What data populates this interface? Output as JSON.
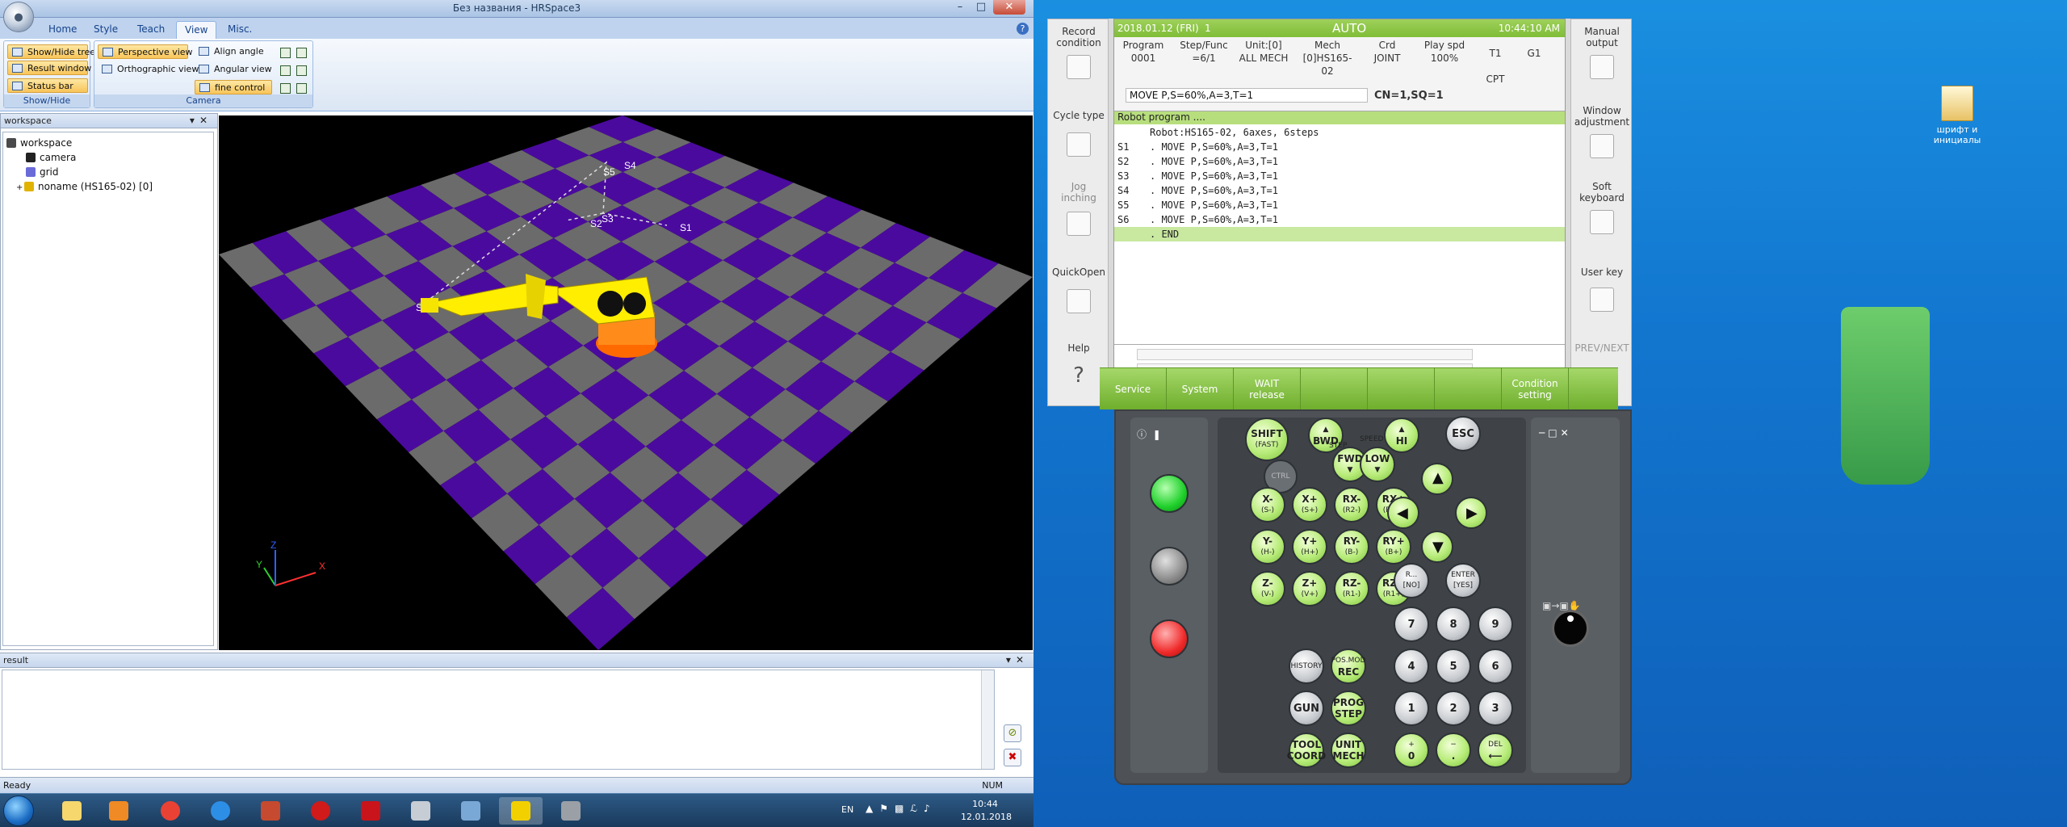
{
  "app": {
    "window_title": "Без названия - HRSpace3",
    "orb_glyph": "●"
  },
  "ribbon": {
    "tabs": [
      {
        "label": "Home"
      },
      {
        "label": "Style"
      },
      {
        "label": "Teach"
      },
      {
        "label": "View"
      },
      {
        "label": "Misc."
      }
    ],
    "active_tab": "View",
    "groups": {
      "showhide": {
        "label": "Show/Hide",
        "buttons": [
          "Show/Hide tree",
          "Result window",
          "Status bar"
        ]
      },
      "camera": {
        "label": "Camera",
        "buttons": [
          "Perspective view",
          "Orthographic view",
          "Align angle",
          "Angular view",
          "fine control"
        ]
      }
    }
  },
  "workspace": {
    "panel_title": "workspace",
    "tree": [
      {
        "label": "workspace",
        "level": 0
      },
      {
        "label": "camera",
        "level": 1
      },
      {
        "label": "grid",
        "level": 1
      },
      {
        "label": "noname (HS165-02) [0]",
        "level": 1
      }
    ]
  },
  "viewport": {
    "step_labels": [
      "S1",
      "S2",
      "S3",
      "S4",
      "S5",
      "S6"
    ],
    "axis_labels": [
      "X",
      "Y",
      "Z"
    ],
    "colors": {
      "floor_a": "#4b0a9e",
      "floor_b": "#6b6b6b",
      "robot": "#ffee00",
      "base": "#ff6a00"
    }
  },
  "result": {
    "panel_title": "result"
  },
  "statusbar": {
    "text": "Ready",
    "num": "NUM"
  },
  "taskbar": {
    "lang": "EN",
    "time": "10:44",
    "date": "12.01.2018"
  },
  "desktop": {
    "icon_label": "шрифт и инициалы"
  },
  "pendant": {
    "left_col": [
      {
        "label": "Record condition"
      },
      {
        "label": "Cycle type"
      },
      {
        "label": "Jog inching"
      },
      {
        "label": "QuickOpen"
      },
      {
        "label": "Help"
      }
    ],
    "right_col": [
      {
        "label": "Manual output"
      },
      {
        "label": "Window adjustment"
      },
      {
        "label": "Soft keyboard"
      },
      {
        "label": "User key"
      },
      {
        "label": "PREV/NEXT"
      }
    ],
    "header": {
      "date": "2018.01.12 (FRI)",
      "mode": "AUTO",
      "time": "10:44:10 AM",
      "slot": "1"
    },
    "info": {
      "program_label": "Program",
      "program_value": "0001",
      "step_label": "Step/Func",
      "step_value": "=6/1",
      "unit_label": "Unit:[0]",
      "unit_value": "ALL MECH",
      "mech_label": "Mech",
      "mech_value": "[0]HS165-02",
      "crd_label": "Crd",
      "crd_value": "JOINT",
      "spd_label": "Play spd",
      "spd_value": "100%",
      "t1_label": "T1",
      "t1_value": "CPT",
      "g1_label": "G1"
    },
    "cmdline": "MOVE P,S=60%,A=3,T=1",
    "cnsq": "CN=1,SQ=1",
    "program_title": "Robot program ....",
    "program_lines": [
      {
        "label": "",
        "text": "Robot:HS165-02, 6axes, 6steps"
      },
      {
        "label": "S1",
        "text": ". MOVE P,S=60%,A=3,T=1"
      },
      {
        "label": "S2",
        "text": ". MOVE P,S=60%,A=3,T=1"
      },
      {
        "label": "S3",
        "text": ". MOVE P,S=60%,A=3,T=1"
      },
      {
        "label": "S4",
        "text": ". MOVE P,S=60%,A=3,T=1"
      },
      {
        "label": "S5",
        "text": ". MOVE P,S=60%,A=3,T=1"
      },
      {
        "label": "S6",
        "text": ". MOVE P,S=60%,A=3,T=1"
      },
      {
        "label": "",
        "text": ". END"
      }
    ],
    "fkeys": [
      "Service",
      "System",
      "WAIT release",
      "",
      "",
      "",
      "Condition setting"
    ],
    "keys": {
      "shift": "SHIFT",
      "shift_sub": "(FAST)",
      "ctrl": "CTRL",
      "bwd": "BWD",
      "fwd": "FWD",
      "step": "STEP",
      "hi": "HI",
      "low": "LOW",
      "speed": "SPEED",
      "esc": "ESC",
      "jog": [
        {
          "main": "X-",
          "sub": "(S-)"
        },
        {
          "main": "X+",
          "sub": "(S+)"
        },
        {
          "main": "RX-",
          "sub": "(R2-)"
        },
        {
          "main": "RX+",
          "sub": "(R2+)"
        },
        {
          "main": "Y-",
          "sub": "(H-)"
        },
        {
          "main": "Y+",
          "sub": "(H+)"
        },
        {
          "main": "RY-",
          "sub": "(B-)"
        },
        {
          "main": "RY+",
          "sub": "(B+)"
        },
        {
          "main": "Z-",
          "sub": "(V-)"
        },
        {
          "main": "Z+",
          "sub": "(V+)"
        },
        {
          "main": "RZ-",
          "sub": "(R1-)"
        },
        {
          "main": "RZ+",
          "sub": "(R1+)"
        }
      ],
      "r_no": "R...",
      "r_no_sub": "[NO]",
      "enter": "ENTER",
      "enter_sub": "[YES]",
      "history": "HISTORY",
      "posmod": "POS.MOD",
      "rec": "REC",
      "gun": "GUN",
      "prog": "PROG",
      "prog_step": "STEP",
      "tool": "TOOL",
      "coord": "COORD",
      "unit": "UNIT",
      "mech": "MECH",
      "digits": [
        "7",
        "8",
        "9",
        "4",
        "5",
        "6",
        "1",
        "2",
        "3"
      ],
      "plus": "+",
      "zero": "0",
      "minus": "−",
      "dot": ".",
      "del": "DEL",
      "del_arrow": "⟵"
    }
  }
}
